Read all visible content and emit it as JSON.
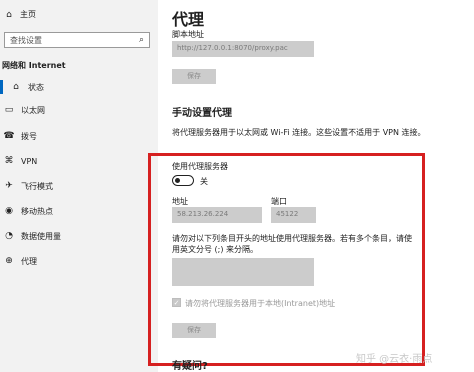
{
  "sidebar": {
    "home_label": "主页",
    "search_placeholder": "查找设置",
    "section_title": "网络和 Internet",
    "items": [
      {
        "label": "状态",
        "icon": "home-icon",
        "active": true
      },
      {
        "label": "以太网",
        "icon": "ethernet-icon"
      },
      {
        "label": "拨号",
        "icon": "dialup-icon"
      },
      {
        "label": "VPN",
        "icon": "vpn-icon"
      },
      {
        "label": "飞行模式",
        "icon": "airplane-icon"
      },
      {
        "label": "移动热点",
        "icon": "hotspot-icon"
      },
      {
        "label": "数据使用量",
        "icon": "data-usage-icon"
      },
      {
        "label": "代理",
        "icon": "proxy-icon"
      }
    ]
  },
  "main": {
    "title": "代理",
    "script_label": "脚本地址",
    "script_value": "http://127.0.0.1:8070/proxy.pac",
    "save1": "保存",
    "manual_title": "手动设置代理",
    "manual_desc": "将代理服务器用于以太网或 Wi-Fi 连接。这些设置不适用于 VPN 连接。",
    "use_proxy_label": "使用代理服务器",
    "toggle_state": "关",
    "address_label": "地址",
    "address_value": "58.213.26.224",
    "port_label": "端口",
    "port_value": "45122",
    "exceptions_desc": "请勿对以下列条目开头的地址使用代理服务器。若有多个条目，请使用英文分号 (;) 来分隔。",
    "local_bypass_label": "请勿将代理服务器用于本地(Intranet)地址",
    "save2": "保存",
    "footer": "有疑问?"
  },
  "watermark": "知乎 @云衣·雨点",
  "colors": {
    "highlight_border": "#d62020",
    "accent": "#0067c0"
  }
}
